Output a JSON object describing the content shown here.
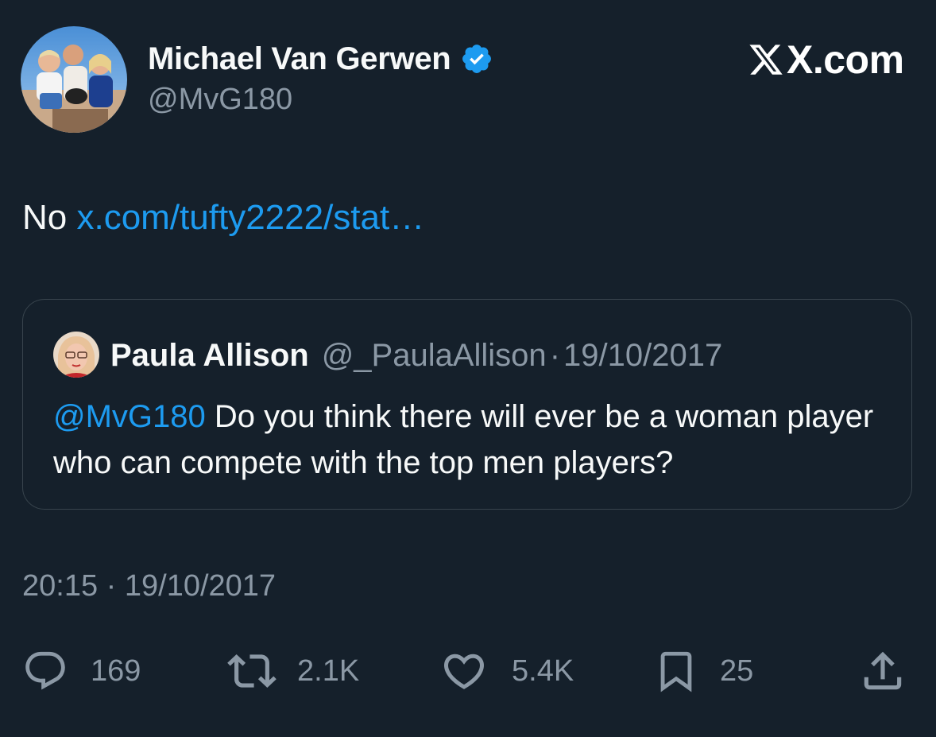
{
  "author": {
    "display_name": "Michael Van Gerwen",
    "handle": "@MvG180",
    "verified": true
  },
  "brand": {
    "text": "X.com",
    "icon": "x-logo-icon"
  },
  "tweet": {
    "text": "No",
    "link_text": "x.com/tufty2222/stat…"
  },
  "quoted_tweet": {
    "display_name": "Paula Allison",
    "handle": "@_PaulaAllison",
    "separator": "·",
    "date": "19/10/2017",
    "mention": "@MvG180",
    "text": " Do you think there will ever be a woman player who can compete with the top men players?"
  },
  "timestamp": "20:15 · 19/10/2017",
  "actions": {
    "replies": "169",
    "reposts": "2.1K",
    "likes": "5.4K",
    "bookmarks": "25"
  },
  "colors": {
    "background": "#15202b",
    "link": "#1d9bf0",
    "muted": "#8b98a5",
    "verified_badge": "#1d9bf0"
  }
}
